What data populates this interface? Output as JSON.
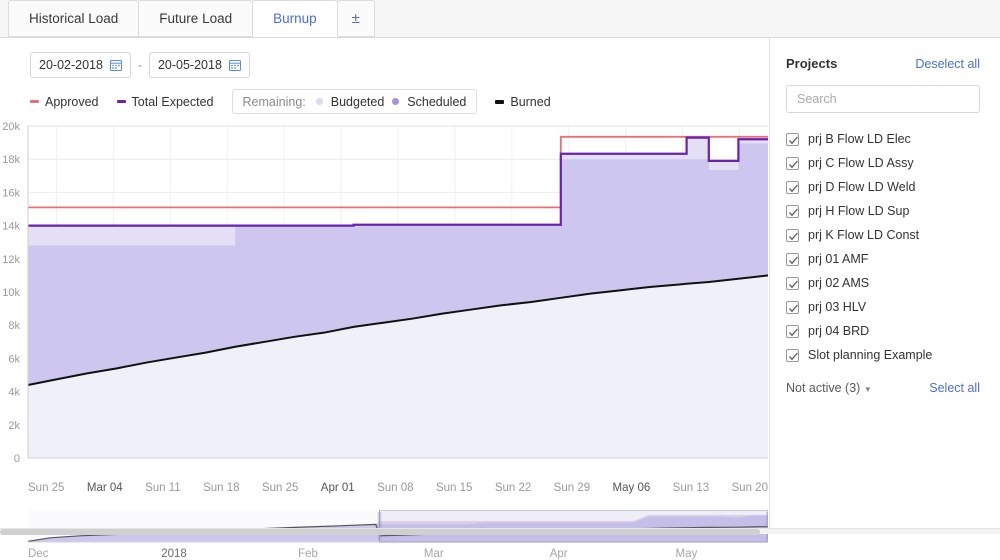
{
  "tabs": [
    {
      "label": "Historical Load",
      "active": false
    },
    {
      "label": "Future Load",
      "active": false
    },
    {
      "label": "Burnup",
      "active": true
    },
    {
      "label": "±",
      "active": false
    }
  ],
  "controls": {
    "start_date": "20-02-2018",
    "end_date": "20-05-2018",
    "separator": "-",
    "calendar_icon": "calendar-icon"
  },
  "legend": {
    "approved": {
      "label": "Approved",
      "color": "#e8707a"
    },
    "total_expected": {
      "label": "Total Expected",
      "color": "#6a1fb5"
    },
    "remaining_title": "Remaining:",
    "budgeted": {
      "label": "Budgeted",
      "color": "#ded9f1"
    },
    "scheduled": {
      "label": "Scheduled",
      "color": "#a393e0"
    },
    "burned": {
      "label": "Burned",
      "color": "#111111"
    }
  },
  "sidebar": {
    "title": "Projects",
    "deselect_all": "Deselect all",
    "select_all": "Select all",
    "not_active": "Not active (3)",
    "search_placeholder": "Search",
    "search_value": "",
    "projects": [
      {
        "label": "prj B Flow LD Elec",
        "checked": true
      },
      {
        "label": "prj C Flow LD Assy",
        "checked": true
      },
      {
        "label": "prj D Flow LD Weld",
        "checked": true
      },
      {
        "label": "prj H Flow LD Sup",
        "checked": true
      },
      {
        "label": "prj K Flow LD Const",
        "checked": true
      },
      {
        "label": "prj 01 AMF",
        "checked": true
      },
      {
        "label": "prj 02 AMS",
        "checked": true
      },
      {
        "label": "prj 03 HLV",
        "checked": true
      },
      {
        "label": "prj 04 BRD",
        "checked": true
      },
      {
        "label": "Slot planning Example",
        "checked": true
      }
    ]
  },
  "chart_data": {
    "type": "area",
    "title": "",
    "xlabel": "",
    "ylabel": "",
    "ylim": [
      0,
      20000
    ],
    "yticks": [
      0,
      2000,
      4000,
      6000,
      8000,
      10000,
      12000,
      14000,
      16000,
      18000,
      20000
    ],
    "ytick_labels": [
      "0",
      "2k",
      "4k",
      "6k",
      "8k",
      "10k",
      "12k",
      "14k",
      "16k",
      "18k",
      "20k"
    ],
    "grid": true,
    "legend_position": "top",
    "x_tick_labels": [
      "Sun 25",
      "Mar 04",
      "Sun 11",
      "Sun 18",
      "Sun 25",
      "Apr 01",
      "Sun 08",
      "Sun 15",
      "Sun 22",
      "Sun 29",
      "May 06",
      "Sun 13",
      "Sun 20"
    ],
    "x_tick_bold": [
      "Mar 04",
      "Apr 01",
      "May 06"
    ],
    "x": [
      0,
      4,
      8,
      12,
      16,
      20,
      24,
      28,
      32,
      36,
      40,
      44,
      48,
      52,
      56,
      60,
      64,
      68,
      72,
      76,
      80,
      84,
      88,
      89,
      92,
      96,
      100
    ],
    "series": [
      {
        "name": "Approved",
        "color": "#e8707a",
        "type": "line",
        "values": [
          15100,
          15100,
          15100,
          15100,
          15100,
          15100,
          15100,
          15100,
          15100,
          15100,
          15100,
          15100,
          15100,
          15100,
          15100,
          15100,
          15100,
          15100,
          19350,
          19350,
          19350,
          19350,
          19350,
          19350,
          19350,
          19350,
          19350
        ]
      },
      {
        "name": "Total Expected",
        "color": "#6a1fb5",
        "type": "line",
        "values": [
          14000,
          14000,
          14000,
          14000,
          14000,
          14000,
          14000,
          14000,
          14000,
          14000,
          14000,
          14050,
          14050,
          14050,
          14050,
          14050,
          14050,
          14050,
          18330,
          18330,
          18330,
          18330,
          18330,
          19300,
          17900,
          19200,
          19200
        ]
      },
      {
        "name": "Budgeted",
        "color": "#ded9f1",
        "type": "area",
        "values": [
          14000,
          14000,
          14000,
          14000,
          14000,
          14000,
          14000,
          14000,
          14000,
          14000,
          14000,
          14050,
          14050,
          14050,
          14050,
          14050,
          14050,
          14050,
          18330,
          18330,
          18330,
          18330,
          18330,
          19300,
          17900,
          19200,
          19200
        ]
      },
      {
        "name": "Scheduled",
        "color": "#cdc6ee",
        "type": "area",
        "values": [
          12800,
          12800,
          12800,
          12800,
          12800,
          12800,
          12800,
          13950,
          13950,
          13950,
          13950,
          13950,
          13950,
          13950,
          13950,
          13950,
          13950,
          13950,
          18000,
          18000,
          18000,
          18000,
          18000,
          18000,
          17350,
          18950,
          18950
        ]
      },
      {
        "name": "Burned",
        "color": "#111111",
        "type": "line",
        "values": [
          4400,
          4750,
          5100,
          5400,
          5750,
          6050,
          6350,
          6700,
          7000,
          7300,
          7550,
          7900,
          8150,
          8400,
          8700,
          8950,
          9200,
          9400,
          9650,
          9900,
          10100,
          10300,
          10450,
          10500,
          10600,
          10800,
          11000
        ]
      }
    ]
  },
  "navigator": {
    "labels": [
      "Dec",
      "2018",
      "Feb",
      "Mar",
      "Apr",
      "May"
    ],
    "bold_labels": [
      "2018"
    ],
    "selection_start_pct": 47.5,
    "selection_end_pct": 100
  }
}
